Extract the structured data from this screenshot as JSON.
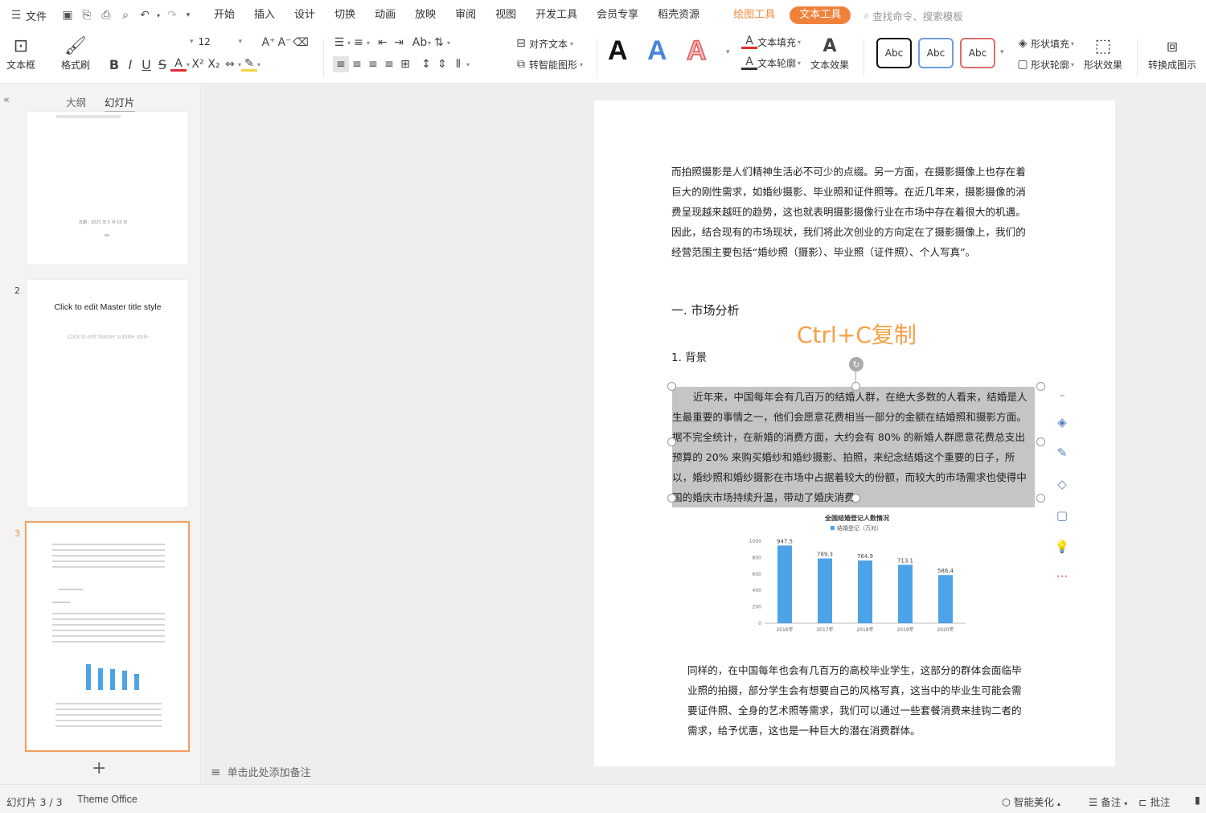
{
  "menubar": {
    "file_label": "文件",
    "tabs": [
      "开始",
      "插入",
      "设计",
      "切换",
      "动画",
      "放映",
      "审阅",
      "视图",
      "开发工具",
      "会员专享",
      "稻壳资源"
    ],
    "drawing_tools": "绘图工具",
    "text_tools": "文本工具",
    "search_placeholder": "查找命令、搜索模板"
  },
  "ribbon": {
    "textbox": "文本框",
    "format_painter": "格式刷",
    "font_size": "12",
    "align_text": "对齐文本",
    "smart_shape": "转智能图形",
    "text_fill": "文本填充",
    "text_outline": "文本轮廓",
    "text_effect": "文本效果",
    "style_sample": "Abc",
    "shape_fill": "形状填充",
    "shape_outline": "形状轮廓",
    "shape_effect": "形状效果",
    "convert_chart": "转换成图示",
    "bigA": "A",
    "colors": {
      "black": "#111111",
      "blue": "#4a86d8",
      "red": "#e05b5b"
    }
  },
  "panel": {
    "tab_outline": "大纲",
    "tab_slides": "幻灯片",
    "thumb1_text": "日期：2021 年 5 月 10 日",
    "thumb2_num": "2",
    "thumb2_title": "Click to edit Master title style",
    "thumb2_subtitle": "Click to edit Master subtitle style",
    "thumb3_num": "3",
    "add_slide": "+"
  },
  "slide": {
    "para1": "而拍照摄影是人们精神生活必不可少的点缀。另一方面，在摄影摄像上也存在着巨大的刚性需求，如婚纱摄影、毕业照和证件照等。在近几年来，摄影摄像的消费呈现越来越旺的趋势，这也就表明摄影摄像行业在市场中存在着很大的机遇。因此，结合现有的市场现状，我们将此次创业的方向定在了摄影摄像上，我们的经营范围主要包括“婚纱照（摄影）、毕业照（证件照）、个人写真”。",
    "heading1": "一. 市场分析",
    "overlay": "Ctrl+C复制",
    "heading2": "1. 背景",
    "para2": "近年来，中国每年会有几百万的结婚人群，在绝大多数的人看来，结婚是人生最重要的事情之一，他们会愿意花费相当一部分的金额在结婚照和摄影方面。据不完全统计，在新婚的消费方面，大约会有 80% 的新婚人群愿意花费总支出预算的 20% 来购买婚纱和婚纱摄影、拍照，来纪念结婚这个重要的日子，所以，婚纱照和婚纱摄影在市场中占据着较大的份额，而较大的市场需求也使得中国的婚庆市场持续升温，带动了婚庆消费。",
    "para3": "同样的，在中国每年也会有几百万的高校毕业学生，这部分的群体会面临毕业照的拍摄，部分学生会有想要自己的风格写真，这当中的毕业生可能会需要证件照、全身的艺术照等需求，我们可以通过一些套餐消费来挂钩二者的需求，给予优惠，这也是一种巨大的潜在消费群体。",
    "overlay_color": "#f5a046"
  },
  "chart_data": {
    "type": "bar",
    "title": "全国结婚登记人数情况",
    "series": [
      {
        "name": "结婚登记（万对）",
        "values": [
          947.5,
          789.3,
          764.9,
          713.1,
          586.4
        ]
      }
    ],
    "categories": [
      "2016年",
      "2017年",
      "2018年",
      "2019年",
      "2020年"
    ],
    "data_labels": [
      "947.5",
      "789.3",
      "764.9",
      "713.1",
      "586.4"
    ],
    "ylim": [
      0,
      1000
    ],
    "y_ticks": [
      "0",
      "200",
      "400",
      "600",
      "800",
      "1000"
    ],
    "bar_color": "#4da3e8",
    "grid": false,
    "legend_position": "top"
  },
  "notes_placeholder": "单击此处添加备注",
  "status": {
    "slide_info": "幻灯片 3 / 3",
    "theme": "Theme Office",
    "beautify": "智能美化",
    "notes": "备注",
    "comment": "批注"
  }
}
